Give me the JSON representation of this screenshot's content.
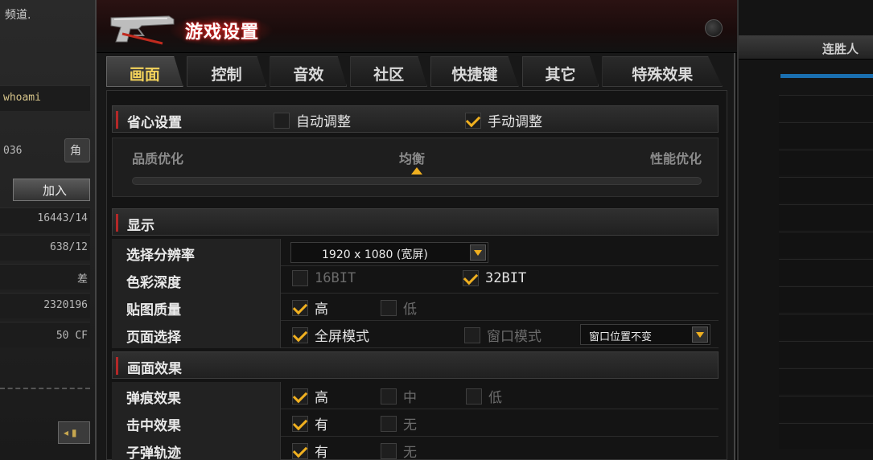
{
  "left_panel": {
    "chat_text": "频道.",
    "username": "whoami",
    "id_text": "036",
    "small_button": "角",
    "join_button": "加入",
    "stats": [
      "16443/14",
      "638/12",
      "差",
      "2320196",
      "50 CF"
    ],
    "nav_button": "◂ ▮"
  },
  "right_panel": {
    "header": "连胜人"
  },
  "dialog": {
    "title": "游戏设置",
    "tabs": [
      "画面",
      "控制",
      "音效",
      "社区",
      "快捷键",
      "其它",
      "特殊效果"
    ],
    "active_tab": 0,
    "sections": {
      "preset": {
        "title": "省心设置",
        "auto_label": "自动调整",
        "auto_checked": false,
        "manual_label": "手动调整",
        "manual_checked": true,
        "slider": {
          "left_label": "品质优化",
          "middle_label": "均衡",
          "right_label": "性能优化",
          "position": 0.5
        }
      },
      "display": {
        "title": "显示",
        "resolution_label": "选择分辨率",
        "resolution_value": "1920 x 1080 (宽屏)",
        "color_depth_label": "色彩深度",
        "color_16": "16BIT",
        "color_16_checked": false,
        "color_32": "32BIT",
        "color_32_checked": true,
        "texture_label": "贴图质量",
        "texture_high": "高",
        "texture_high_checked": true,
        "texture_low": "低",
        "texture_low_checked": false,
        "window_label": "页面选择",
        "fullscreen": "全屏模式",
        "fullscreen_checked": true,
        "windowed": "窗口模式",
        "windowed_checked": false,
        "window_position": "窗口位置不变"
      },
      "effects": {
        "title": "画面效果",
        "bullet_hole_label": "弹痕效果",
        "bullet_hole_options": [
          "高",
          "中",
          "低"
        ],
        "bullet_hole_checked": [
          true,
          false,
          false
        ],
        "hit_label": "击中效果",
        "hit_options": [
          "有",
          "无"
        ],
        "hit_checked": [
          true,
          false
        ],
        "trail_label": "子弹轨迹",
        "trail_options": [
          "有",
          "无"
        ],
        "trail_checked": [
          true,
          false
        ]
      }
    }
  },
  "colors": {
    "accent": "#f0b020",
    "title_glow": "#d02020",
    "progress_blue": "#1a6fb0"
  }
}
